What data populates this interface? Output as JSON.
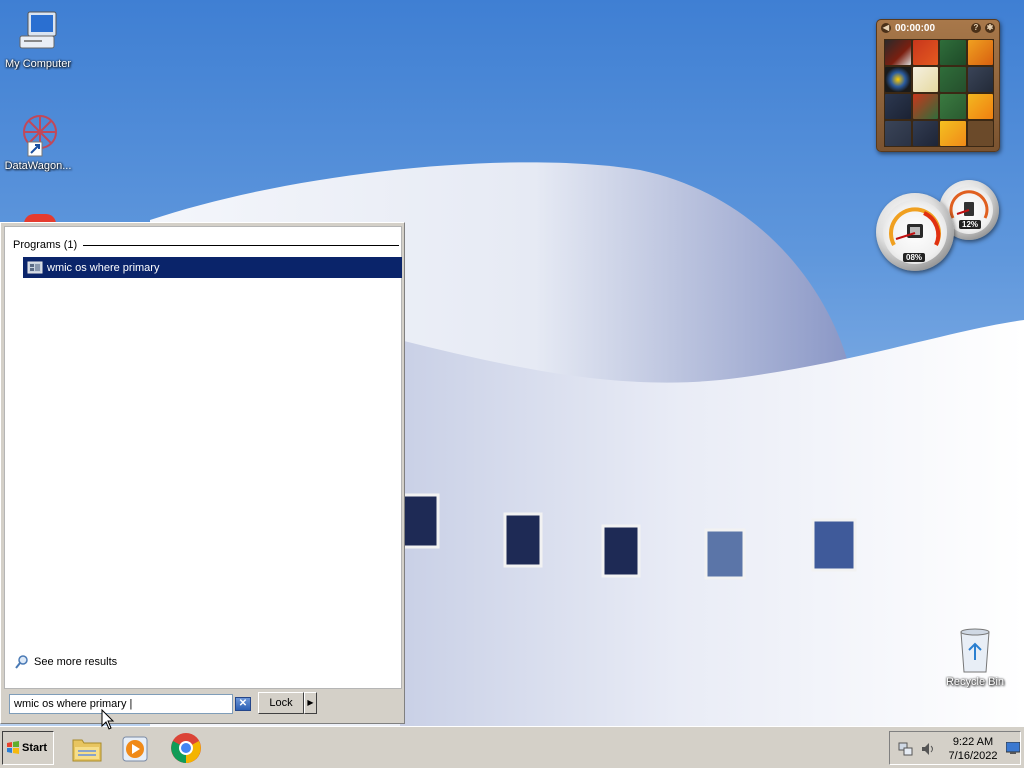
{
  "desktop": {
    "icons": [
      {
        "label": "My Computer",
        "icon": "my-computer-icon"
      },
      {
        "label": "DataWagon...",
        "icon": "datawagon-shortcut-icon"
      },
      {
        "label": "Recycle Bin",
        "icon": "recycle-bin-icon"
      }
    ]
  },
  "gadgets": {
    "puzzle": {
      "timer": "00:00:00"
    },
    "cpu_meter": {
      "cpu": "08%",
      "memory": "12%"
    }
  },
  "start_menu": {
    "section_heading": "Programs (1)",
    "results": [
      {
        "label": "wmic os where primary",
        "icon": "wmic-program-icon",
        "selected": true
      }
    ],
    "see_more": "See more results",
    "search": {
      "value": "wmic os where primary |"
    },
    "clear_label": "✕",
    "lock_label": "Lock",
    "lock_arrow": "▶"
  },
  "taskbar": {
    "start_label": "Start",
    "apps": [
      {
        "name": "Windows Explorer",
        "icon": "explorer-folder-icon"
      },
      {
        "name": "Windows Media Player",
        "icon": "media-player-icon"
      },
      {
        "name": "Google Chrome",
        "icon": "chrome-icon"
      }
    ],
    "clock": {
      "time": "9:22 AM",
      "date": "7/16/2022"
    }
  },
  "colors": {
    "selection": "#0a246a",
    "taskbar": "#d4d0c8"
  }
}
